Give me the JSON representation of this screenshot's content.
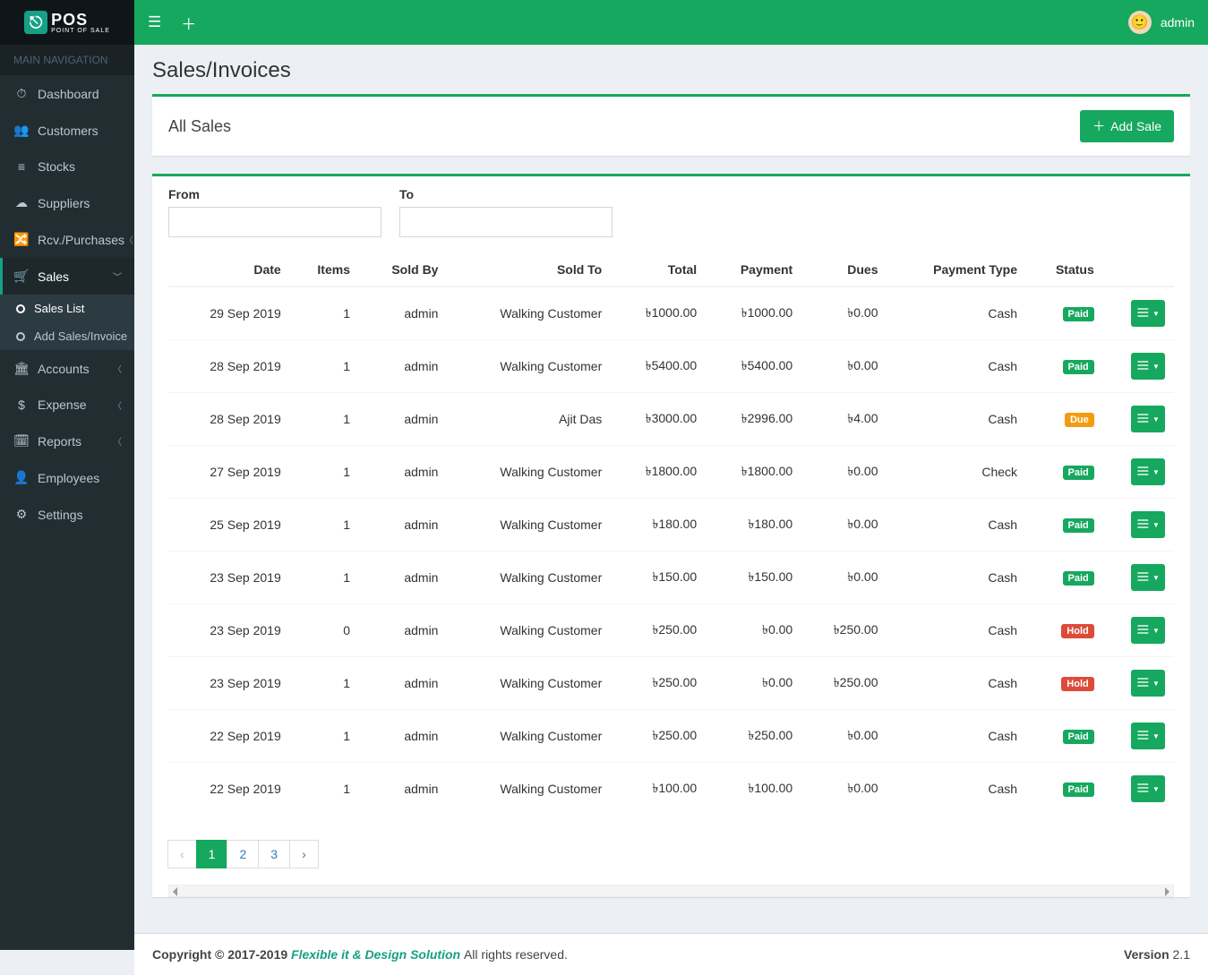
{
  "brand": {
    "title": "POS",
    "subtitle": "POINT OF SALE"
  },
  "nav_header": "MAIN NAVIGATION",
  "nav": [
    {
      "label": "Dashboard",
      "icon": "⏱"
    },
    {
      "label": "Customers",
      "icon": "👥"
    },
    {
      "label": "Stocks",
      "icon": "≡"
    },
    {
      "label": "Suppliers",
      "icon": "☁"
    },
    {
      "label": "Rcv./Purchases",
      "icon": "🔀",
      "caret": true
    },
    {
      "label": "Sales",
      "icon": "🛒",
      "open": true,
      "caret": true,
      "children": [
        {
          "label": "Sales List",
          "active": true
        },
        {
          "label": "Add Sales/Invoice"
        }
      ]
    },
    {
      "label": "Accounts",
      "icon": "🏛",
      "caret": true
    },
    {
      "label": "Expense",
      "icon": "$",
      "caret": true
    },
    {
      "label": "Reports",
      "icon": "🗓",
      "caret": true
    },
    {
      "label": "Employees",
      "icon": "👤"
    },
    {
      "label": "Settings",
      "icon": "⚙"
    }
  ],
  "topbar": {
    "user": "admin"
  },
  "page": {
    "title": "Sales/Invoices",
    "box_title": "All Sales",
    "add_button": "Add Sale",
    "from_label": "From",
    "to_label": "To"
  },
  "columns": [
    "Date",
    "Items",
    "Sold By",
    "Sold To",
    "Total",
    "Payment",
    "Dues",
    "Payment Type",
    "Status",
    ""
  ],
  "rows": [
    {
      "date": "29 Sep 2019",
      "items": "1",
      "sold_by": "admin",
      "sold_to": "Walking Customer",
      "total": "৳1000.00",
      "payment": "৳1000.00",
      "dues": "৳0.00",
      "ptype": "Cash",
      "status": "Paid",
      "badge": "paid"
    },
    {
      "date": "28 Sep 2019",
      "items": "1",
      "sold_by": "admin",
      "sold_to": "Walking Customer",
      "total": "৳5400.00",
      "payment": "৳5400.00",
      "dues": "৳0.00",
      "ptype": "Cash",
      "status": "Paid",
      "badge": "paid"
    },
    {
      "date": "28 Sep 2019",
      "items": "1",
      "sold_by": "admin",
      "sold_to": "Ajit Das",
      "total": "৳3000.00",
      "payment": "৳2996.00",
      "dues": "৳4.00",
      "ptype": "Cash",
      "status": "Due",
      "badge": "due"
    },
    {
      "date": "27 Sep 2019",
      "items": "1",
      "sold_by": "admin",
      "sold_to": "Walking Customer",
      "total": "৳1800.00",
      "payment": "৳1800.00",
      "dues": "৳0.00",
      "ptype": "Check",
      "status": "Paid",
      "badge": "paid"
    },
    {
      "date": "25 Sep 2019",
      "items": "1",
      "sold_by": "admin",
      "sold_to": "Walking Customer",
      "total": "৳180.00",
      "payment": "৳180.00",
      "dues": "৳0.00",
      "ptype": "Cash",
      "status": "Paid",
      "badge": "paid"
    },
    {
      "date": "23 Sep 2019",
      "items": "1",
      "sold_by": "admin",
      "sold_to": "Walking Customer",
      "total": "৳150.00",
      "payment": "৳150.00",
      "dues": "৳0.00",
      "ptype": "Cash",
      "status": "Paid",
      "badge": "paid"
    },
    {
      "date": "23 Sep 2019",
      "items": "0",
      "sold_by": "admin",
      "sold_to": "Walking Customer",
      "total": "৳250.00",
      "payment": "৳0.00",
      "dues": "৳250.00",
      "ptype": "Cash",
      "status": "Hold",
      "badge": "hold"
    },
    {
      "date": "23 Sep 2019",
      "items": "1",
      "sold_by": "admin",
      "sold_to": "Walking Customer",
      "total": "৳250.00",
      "payment": "৳0.00",
      "dues": "৳250.00",
      "ptype": "Cash",
      "status": "Hold",
      "badge": "hold"
    },
    {
      "date": "22 Sep 2019",
      "items": "1",
      "sold_by": "admin",
      "sold_to": "Walking Customer",
      "total": "৳250.00",
      "payment": "৳250.00",
      "dues": "৳0.00",
      "ptype": "Cash",
      "status": "Paid",
      "badge": "paid"
    },
    {
      "date": "22 Sep 2019",
      "items": "1",
      "sold_by": "admin",
      "sold_to": "Walking Customer",
      "total": "৳100.00",
      "payment": "৳100.00",
      "dues": "৳0.00",
      "ptype": "Cash",
      "status": "Paid",
      "badge": "paid"
    }
  ],
  "pagination": {
    "prev": "‹",
    "pages": [
      "1",
      "2",
      "3"
    ],
    "next": "›",
    "active": 0
  },
  "footer": {
    "copyright": "Copyright © 2017-2019",
    "brand": "Flexible it & Design Solution",
    "rights": "All rights reserved.",
    "version_label": "Version",
    "version": "2.1"
  }
}
